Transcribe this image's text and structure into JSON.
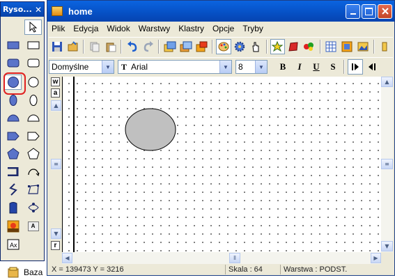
{
  "palette": {
    "title": "Ryso...",
    "close": "✕",
    "tools": [
      "pointer",
      "rectangle-filled",
      "rectangle-outline",
      "rounded-rect-filled",
      "rounded-rect-outline",
      "circle-filled",
      "circle-outline",
      "ellipse-filled",
      "ellipse-outline",
      "half-circle-filled",
      "half-circle-outline",
      "arrow-pentagon-filled",
      "arrow-pentagon-outline",
      "pentagon-filled",
      "pentagon-outline",
      "bracket-shape",
      "arc",
      "zigzag-line",
      "polyline",
      "curve",
      "node-curve",
      "picture",
      "text-box",
      "text-frame"
    ],
    "text_tool_label": "A"
  },
  "window": {
    "title": "home",
    "menu": [
      "Plik",
      "Edycja",
      "Widok",
      "Warstwy",
      "Klastry",
      "Opcje",
      "Tryby"
    ]
  },
  "format": {
    "style": "Domyślne",
    "font": "Arial",
    "font_icon": "T",
    "size": "8",
    "bold": "B",
    "italic": "I",
    "underline": "U",
    "strike": "S"
  },
  "side_tabs": [
    "w",
    "a",
    "r"
  ],
  "status": {
    "coords": "X = 139473  Y = 3216",
    "scale": "Skala : 64",
    "layer": "Warstwa : PODST."
  },
  "taskbar": {
    "label": "Baza"
  },
  "colors": {
    "title_blue": "#0650c4",
    "ellipse_fill": "#c0c0c0",
    "highlight": "#e02020"
  }
}
